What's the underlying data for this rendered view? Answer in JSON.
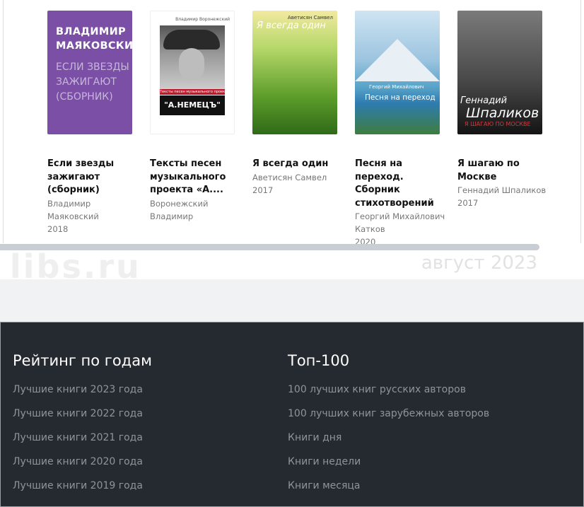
{
  "books": [
    {
      "cover_author": "ВЛАДИМИР МАЯКОВСКИЙ",
      "cover_subtitle": "ЕСЛИ ЗВЕЗДЫ ЗАЖИГАЮТ (СБОРНИК)",
      "title": "Если звезды зажигают (сборник)",
      "author": "Владимир Маяковский",
      "year": "2018"
    },
    {
      "cover_author": "Владимир Воронежский",
      "cover_band": "Тексты песен музыкального проекта",
      "cover_title": "\"А.НЕМЕЦЪ\"",
      "title": "Тексты песен музыкального проекта «А....",
      "author": "Воронежский Владимир",
      "year": ""
    },
    {
      "cover_author": "Аветисян Самвел",
      "cover_title": "Я всегда один",
      "title": "Я всегда один",
      "author": "Аветисян Самвел",
      "year": "2017"
    },
    {
      "cover_author": "Георгий Михайлович",
      "cover_title": "Песня на переход",
      "title": "Песня на переход. Сборник стихотворений",
      "author": "Георгий Михайлович Катков",
      "year": "2020"
    },
    {
      "cover_author": "Геннадий",
      "cover_author2": "Шпаликов",
      "cover_title": "Я ШАГАЮ ПО МОСКВЕ",
      "title": "Я шагаю по Москве",
      "author": "Геннадий Шпаликов",
      "year": "2017"
    }
  ],
  "watermark": "libs.ru",
  "date_stamp": "август 2023",
  "footer": {
    "left_title": "Рейтинг по годам",
    "left_links": [
      "Лучшие книги 2023 года",
      "Лучшие книги 2022 года",
      "Лучшие книги 2021 года",
      "Лучшие книги 2020 года",
      "Лучшие книги 2019 года"
    ],
    "right_title": "Топ-100",
    "right_links": [
      "100 лучших книг русских авторов",
      "100 лучших книг зарубежных авторов",
      "Книги дня",
      "Книги недели",
      "Книги месяца"
    ]
  },
  "colors": {
    "footer_bg": "#252a30",
    "link": "#8e949a",
    "cover1": "#7c4fa6"
  }
}
